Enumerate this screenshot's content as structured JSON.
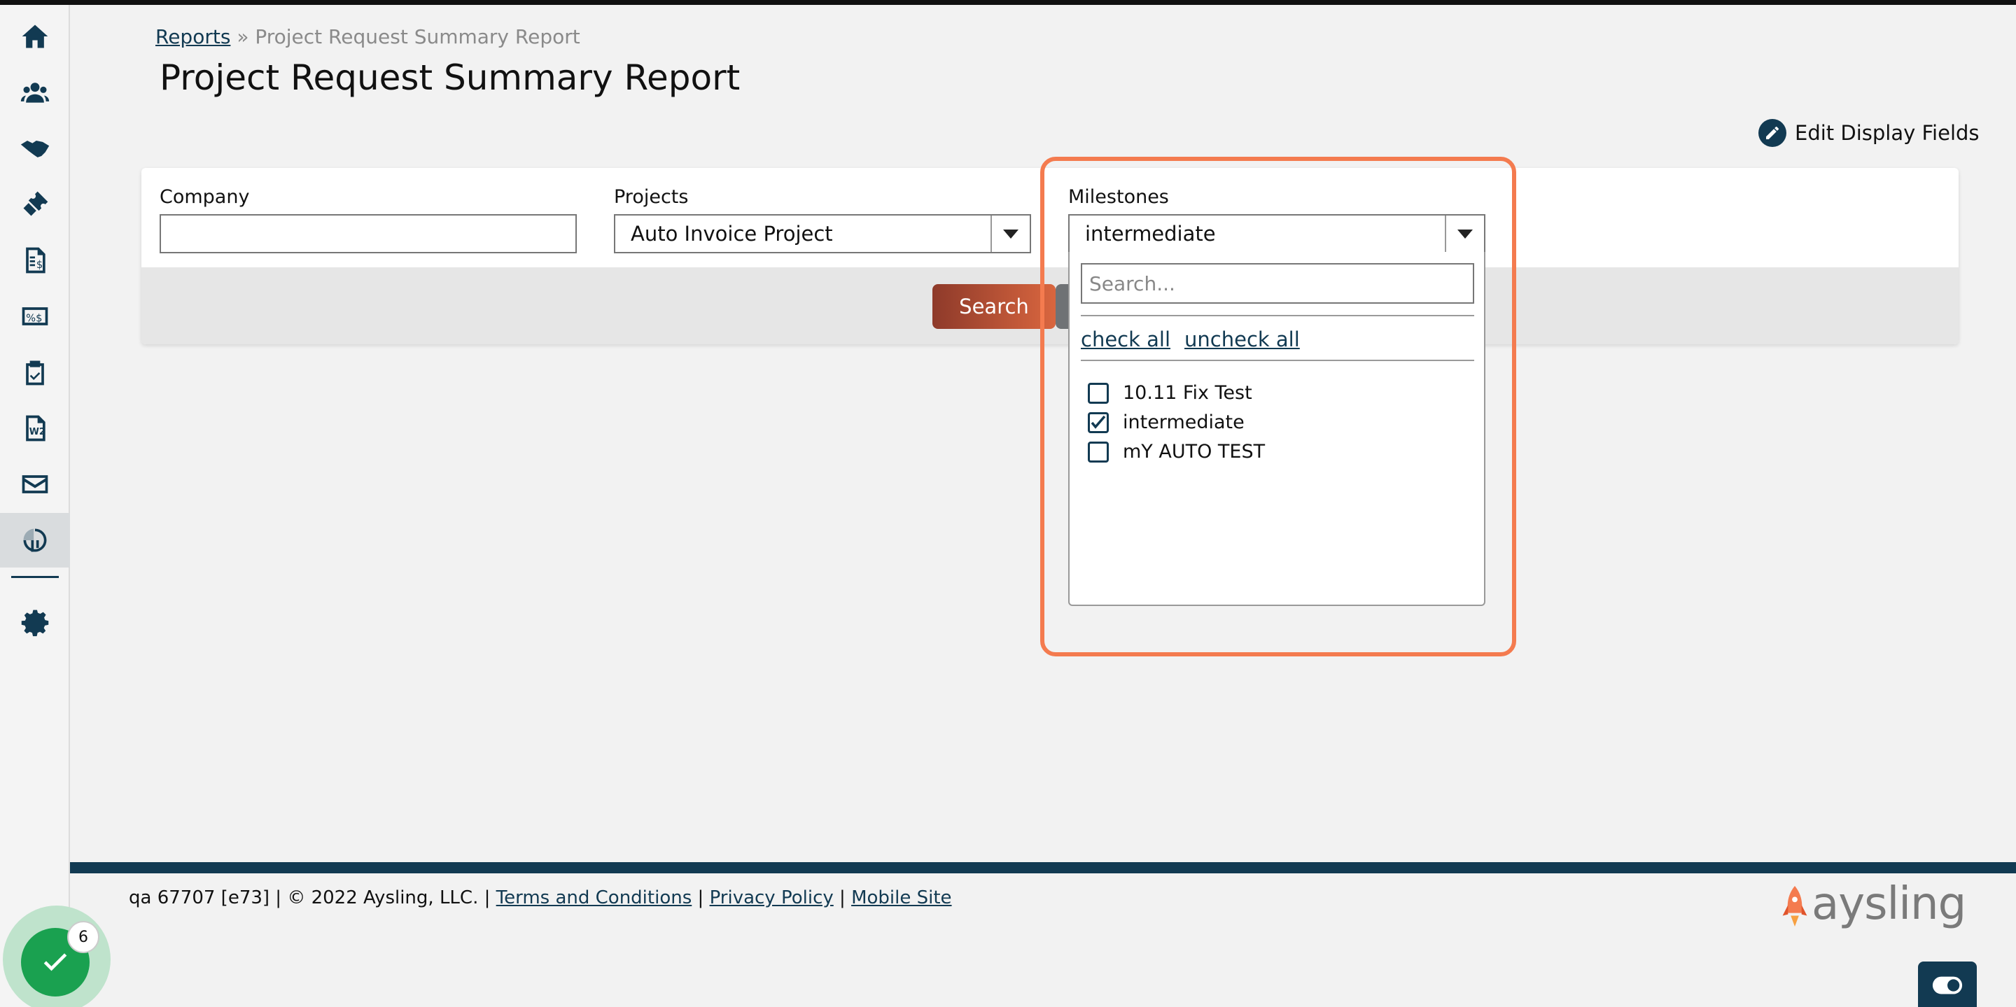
{
  "breadcrumb": {
    "link": "Reports",
    "separator": "»",
    "current": "Project Request Summary Report"
  },
  "page_title": "Project Request Summary Report",
  "edit_fields_label": "Edit Display Fields",
  "filters": {
    "company": {
      "label": "Company",
      "value": ""
    },
    "projects": {
      "label": "Projects",
      "value": "Auto Invoice Project"
    },
    "milestones": {
      "label": "Milestones",
      "value": "intermediate"
    }
  },
  "search_button": "Search",
  "milestone_dropdown": {
    "search_placeholder": "Search...",
    "check_all": "check all",
    "uncheck_all": "uncheck all",
    "options": [
      {
        "label": "10.11 Fix Test",
        "checked": false
      },
      {
        "label": "intermediate",
        "checked": true
      },
      {
        "label": "mY AUTO TEST",
        "checked": false
      }
    ]
  },
  "footer": {
    "info": "qa 67707 [e73] | © 2022 Aysling, LLC. |",
    "terms": "Terms and Conditions",
    "sep": "|",
    "privacy": "Privacy Policy",
    "mobile": "Mobile Site"
  },
  "logo_text": "aysling",
  "notification_count": "6",
  "sidebar_icons": [
    "home-icon",
    "people-icon",
    "handshake-icon",
    "ticket-icon",
    "invoice-icon",
    "expense-icon",
    "clipboard-check-icon",
    "w2-icon",
    "mail-icon",
    "reports-icon",
    "gear-icon"
  ],
  "colors": {
    "brand": "#123a52",
    "accent": "#f47b4f",
    "success": "#1aa150"
  }
}
